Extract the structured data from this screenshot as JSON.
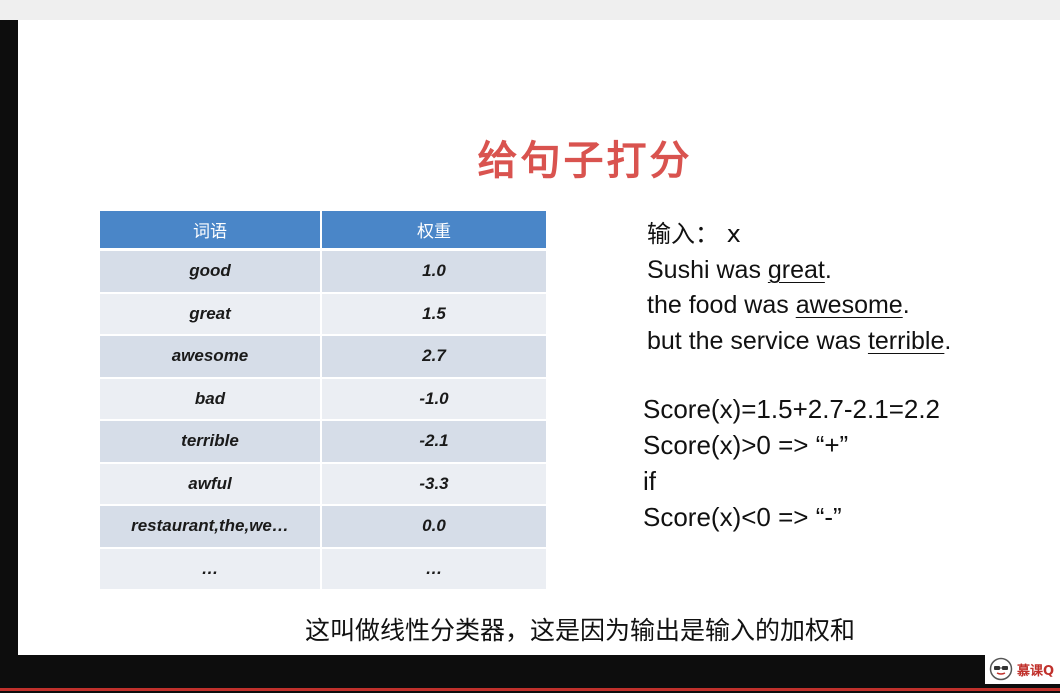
{
  "slide": {
    "title": "给句子打分",
    "table": {
      "headers": [
        "词语",
        "权重"
      ],
      "rows": [
        [
          "good",
          "1.0"
        ],
        [
          "great",
          "1.5"
        ],
        [
          "awesome",
          "2.7"
        ],
        [
          "bad",
          "-1.0"
        ],
        [
          "terrible",
          "-2.1"
        ],
        [
          "awful",
          "-3.3"
        ],
        [
          "restaurant,the,we…",
          "0.0"
        ],
        [
          "…",
          "…"
        ]
      ]
    },
    "input": {
      "label": "输入： x",
      "line1_pre": "Sushi was ",
      "line1_word": "great",
      "line1_post": ".",
      "line2_pre": "the food was ",
      "line2_word": "awesome",
      "line2_post": ".",
      "line3_pre": "but the service was ",
      "line3_word": "terrible",
      "line3_post": "."
    },
    "score": {
      "line1": "Score(x)=1.5+2.7-2.1=2.2",
      "line2": "Score(x)>0 => “+”",
      "line3": "if",
      "line4": "Score(x)<0 => “-”"
    },
    "caption": "这叫做线性分类器，这是因为输出是输入的加权和"
  },
  "logo": {
    "icon": "mooc-logo-icon",
    "text": "慕课Q"
  },
  "colors": {
    "title": "#d9534f",
    "table_header": "#4a86c8",
    "row_dark": "#d6dde8",
    "row_light": "#ebeef3",
    "accent_line": "#c0302b"
  }
}
